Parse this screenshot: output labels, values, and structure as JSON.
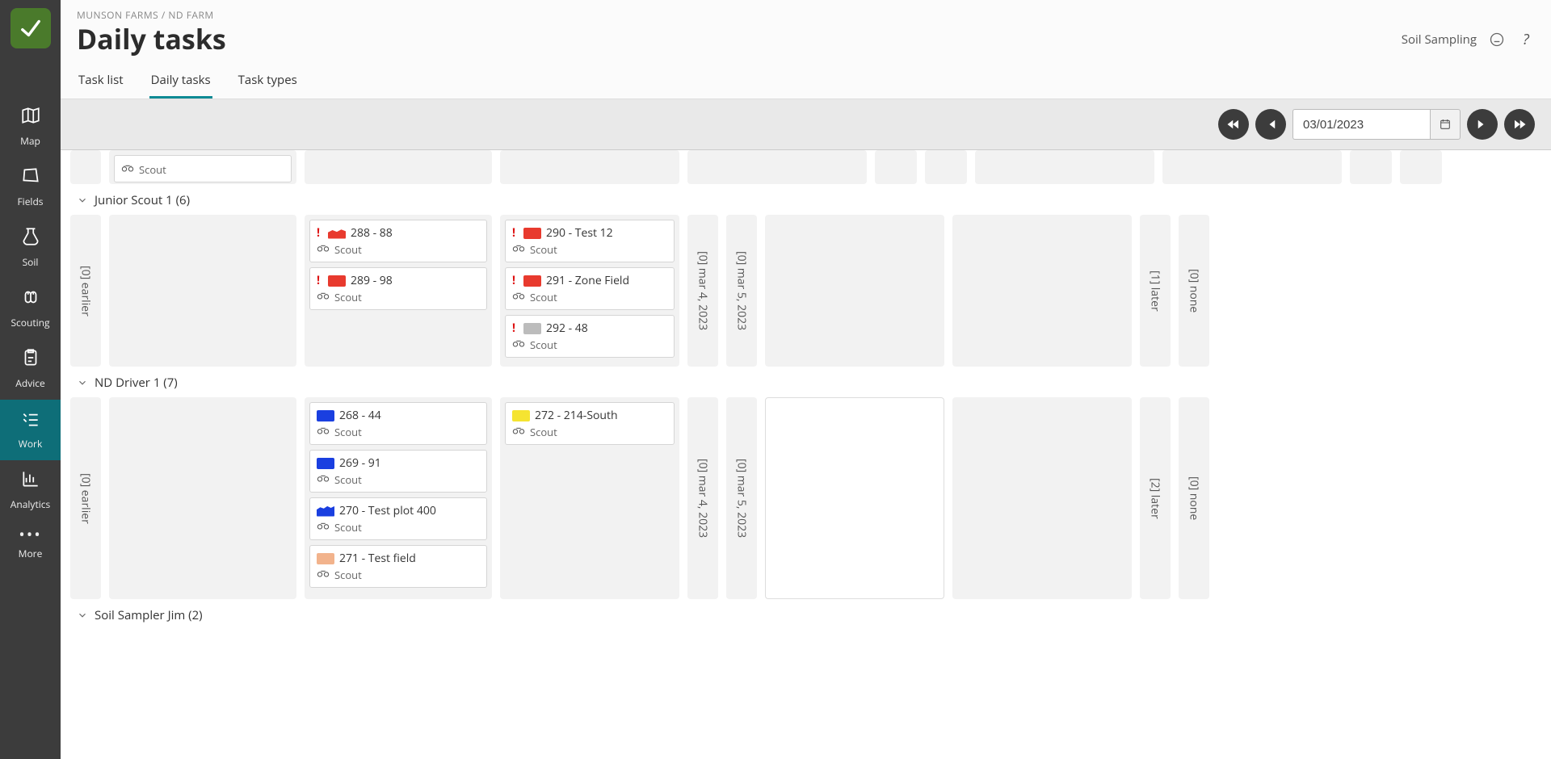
{
  "breadcrumb": "MUNSON FARMS / ND FARM",
  "page_title": "Daily tasks",
  "top_right_label": "Soil Sampling",
  "tabs": {
    "task_list": "Task list",
    "daily_tasks": "Daily tasks",
    "task_types": "Task types"
  },
  "date_value": "03/01/2023",
  "nav": {
    "map": "Map",
    "fields": "Fields",
    "soil": "Soil",
    "scouting": "Scouting",
    "advice": "Advice",
    "work": "Work",
    "analytics": "Analytics",
    "more": "More"
  },
  "scout_label": "Scout",
  "groups": {
    "junior": {
      "title": "Junior Scout 1 (6)"
    },
    "driver": {
      "title": "ND Driver 1 (7)"
    },
    "sampler": {
      "title": "Soil Sampler Jim (2)"
    }
  },
  "col_labels": {
    "earlier0": "[0] earlier",
    "mar4_0": "[0] mar 4, 2023",
    "mar5_0": "[0] mar 5, 2023",
    "later1": "[1] later",
    "later2": "[2] later",
    "none0": "[0] none"
  },
  "cards": {
    "c288": "288 - 88",
    "c289": "289 - 98",
    "c290": "290 - Test 12",
    "c291": "291 - Zone Field",
    "c292": "292 - 48",
    "c268": "268 - 44",
    "c269": "269 - 91",
    "c270": "270 - Test plot 400",
    "c271": "271 - Test field",
    "c272": "272 - 214-South"
  }
}
